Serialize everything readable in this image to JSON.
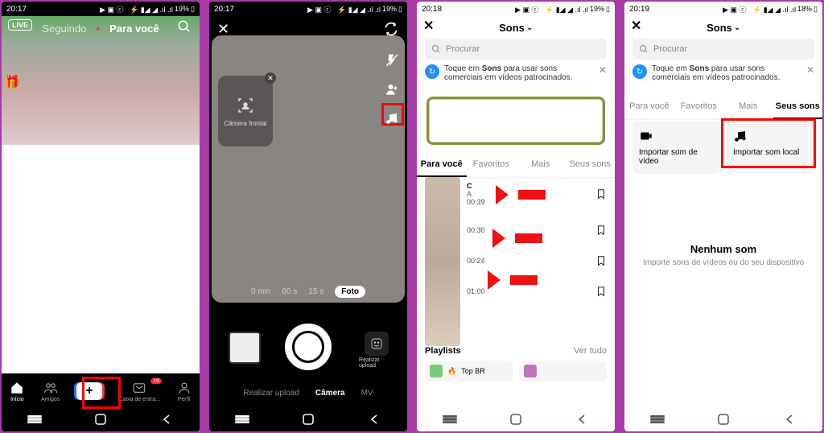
{
  "status": {
    "time1": "20:17",
    "time2": "20:17",
    "time3": "20:18",
    "time4": "20:19",
    "batt1": "19%",
    "batt2": "19%",
    "batt3": "19%",
    "batt4": "18%",
    "icons": "◂ ▸ ▣ ✆"
  },
  "s1": {
    "live": "LIVE",
    "seguindo": "Seguindo",
    "para_voce": "Para você",
    "nav": {
      "inicio": "Início",
      "amigos": "Amigos",
      "caixa": "Caixa de entra...",
      "perfil": "Perfil",
      "badge": "18"
    }
  },
  "s2": {
    "frontal": "Câmera frontal",
    "modes": {
      "m10": "0 min",
      "m60": "60 s",
      "m15": "15 s",
      "foto": "Foto"
    },
    "tabs": {
      "upload": "Realizar upload",
      "camera": "Câmera",
      "mv": "MV"
    },
    "effects": "Realizar upload"
  },
  "sheet": {
    "title": "Sons",
    "search": "Procurar",
    "tip_pre": "Toque em ",
    "tip_b": "Sons",
    "tip_post": " para usar sons comerciais em vídeos patrocinados.",
    "tabs": {
      "para": "Para você",
      "fav": "Favoritos",
      "mais": "Mais",
      "seus": "Seus sons"
    },
    "songs": [
      {
        "d": "00:39"
      },
      {
        "d": "00:30"
      },
      {
        "d": "00:24"
      },
      {
        "d": "01:00"
      }
    ],
    "playlists": "Playlists",
    "verall": "Ver tudo",
    "topbr": "Top BR"
  },
  "s4": {
    "imp_video": "Importar som de vídeo",
    "imp_local": "Importar som local",
    "empty_t": "Nenhum som",
    "empty_s": "Importe sons de vídeos ou do seu dispositivo"
  }
}
